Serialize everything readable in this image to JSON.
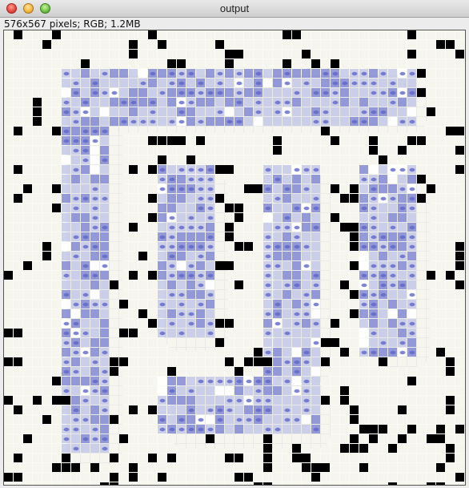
{
  "window": {
    "title": "output",
    "controls": [
      "close-button",
      "minimize-button",
      "zoom-button"
    ]
  },
  "image_info": "576x567 pixels; RGB; 1.2MB",
  "colors": {
    "tile_fill": "#f6f6ee",
    "tile_blue": "#8a8fd6",
    "tile_blue_light": "#c7cbe9",
    "black_tile": "#000000",
    "shadow": "#d9d9d9"
  }
}
